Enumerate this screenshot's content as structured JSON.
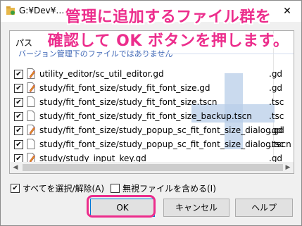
{
  "window": {
    "title": "G:¥Dev¥… … … … … …",
    "close_glyph": "✕"
  },
  "overlay": {
    "line1": "管理に追加するファイル群を",
    "line2": "確認して OK ボタンを押します。"
  },
  "list": {
    "column_header": "パス",
    "group_label": "バージョン管理下のファイルではありません",
    "rows": [
      {
        "checked": true,
        "icon": "edited-file-icon",
        "path": "utility_editor/sc_util_editor.gd",
        "ext": ".gd"
      },
      {
        "checked": true,
        "icon": "edited-file-icon",
        "path": "study/fit_font_size/study_fit_font_size.gd",
        "ext": ".gd"
      },
      {
        "checked": true,
        "icon": "file-icon",
        "path": "study/fit_font_size/study_fit_font_size.tscn",
        "ext": ".tsc"
      },
      {
        "checked": true,
        "icon": "file-icon",
        "path": "study/fit_font_size/study_fit_font_size_backup.tscn",
        "ext": ".tsc"
      },
      {
        "checked": true,
        "icon": "edited-file-icon",
        "path": "study/fit_font_size/study_popup_sc_fit_font_size_dialog.gd",
        "ext": ".gd"
      },
      {
        "checked": true,
        "icon": "file-icon",
        "path": "study/fit_font_size/study_popup_sc_fit_font_size_dialog.tscn",
        "ext": ".tsc"
      },
      {
        "checked": true,
        "icon": "edited-file-icon",
        "path": "study/study_input_key.gd",
        "ext": ".gd"
      }
    ]
  },
  "options": {
    "select_all_label": "すべてを選択/解除(A)",
    "select_all_checked": true,
    "include_ignored_label": "無視ファイルを含める(I)",
    "include_ignored_checked": false
  },
  "buttons": {
    "ok": "OK",
    "cancel": "キャンセル",
    "help": "ヘルプ"
  },
  "colors": {
    "accent": "#ec2d8c",
    "group_text": "#3b64b5",
    "plus_watermark": "#b8cee8"
  },
  "check_glyph": "✔"
}
